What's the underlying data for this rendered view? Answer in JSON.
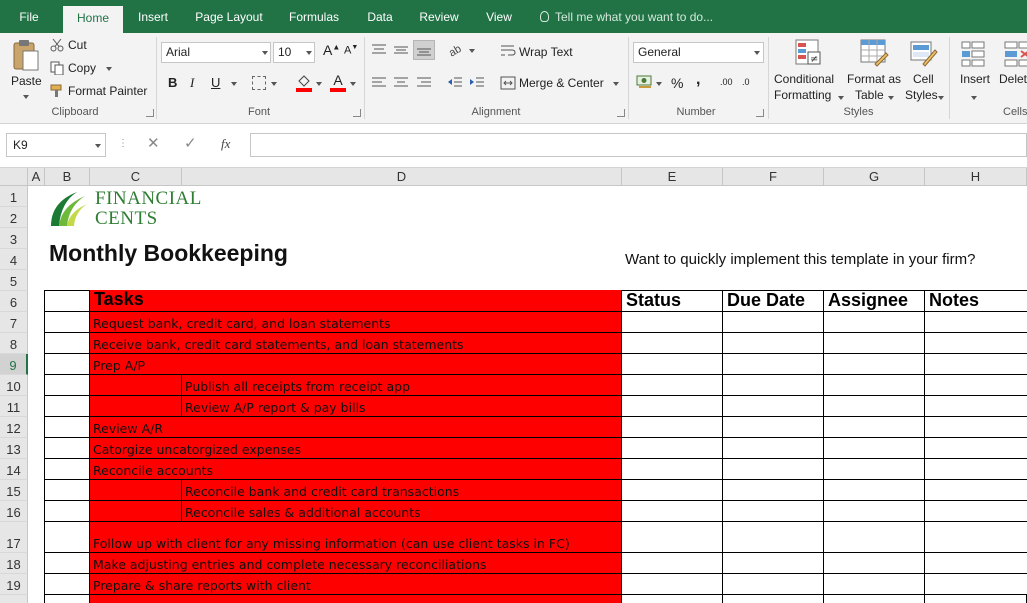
{
  "tabs": [
    "File",
    "Home",
    "Insert",
    "Page Layout",
    "Formulas",
    "Data",
    "Review",
    "View"
  ],
  "active_tab": "Home",
  "tell_me": "Tell me what you want to do...",
  "clipboard": {
    "paste": "Paste",
    "cut": "Cut",
    "copy": "Copy",
    "format_painter": "Format Painter",
    "label": "Clipboard"
  },
  "font": {
    "name": "Arial",
    "size": "10",
    "bold": "B",
    "italic": "I",
    "underline": "U",
    "label": "Font"
  },
  "alignment": {
    "wrap_text": "Wrap Text",
    "merge_center": "Merge & Center",
    "label": "Alignment"
  },
  "number": {
    "format": "General",
    "percent": "%",
    "comma": ",",
    "inc_decimal": ".00",
    "dec_decimal": ".0",
    "label": "Number"
  },
  "styles": {
    "conditional": "Conditional",
    "conditional2": "Formatting",
    "format_as": "Format as",
    "format_as2": "Table",
    "cell_styles": "Cell",
    "cell_styles2": "Styles",
    "label": "Styles"
  },
  "cells": {
    "insert": "Insert",
    "delete": "Delete",
    "label": "Cells"
  },
  "formula_bar": {
    "name_box": "K9",
    "fx": "fx",
    "content": ""
  },
  "columns": [
    "A",
    "B",
    "C",
    "D",
    "E",
    "F",
    "G",
    "H"
  ],
  "rows": [
    "1",
    "2",
    "3",
    "4",
    "5",
    "6",
    "7",
    "8",
    "9",
    "10",
    "11",
    "12",
    "13",
    "14",
    "15",
    "16",
    "17",
    "18",
    "19"
  ],
  "selected_row": "9",
  "logo": {
    "line1": "FINANCIAL",
    "line2": "CENTS"
  },
  "title": "Monthly Bookkeeping",
  "promo": "Want to quickly implement this template in your firm?",
  "table_headers": {
    "tasks": "Tasks",
    "status": "Status",
    "due_date": "Due Date",
    "assignee": "Assignee",
    "notes": "Notes"
  },
  "tasks": [
    {
      "text": "Request bank, credit card, and loan statements",
      "indent": false
    },
    {
      "text": "Receive bank, credit card statements, and loan statements",
      "indent": false
    },
    {
      "text": "Prep A/P",
      "indent": false
    },
    {
      "text": "Publish all receipts from receipt app",
      "indent": true
    },
    {
      "text": "Review A/P report & pay bills",
      "indent": true
    },
    {
      "text": "Review A/R",
      "indent": false
    },
    {
      "text": "Catorgize uncatorgized expenses",
      "indent": false
    },
    {
      "text": "Reconcile accounts",
      "indent": false
    },
    {
      "text": "Reconcile bank and credit card transactions",
      "indent": true
    },
    {
      "text": "Reconcile sales & additional accounts",
      "indent": true
    },
    {
      "text": "Follow up with client for any missing information (can use client tasks in FC)",
      "indent": false
    },
    {
      "text": "Make adjusting entries and complete necessary reconciliations",
      "indent": false
    },
    {
      "text": "Prepare & share reports with client",
      "indent": false
    }
  ],
  "colors": {
    "excel_green": "#217346",
    "task_red": "#ff0000",
    "logo_green": "#2e7d32"
  }
}
